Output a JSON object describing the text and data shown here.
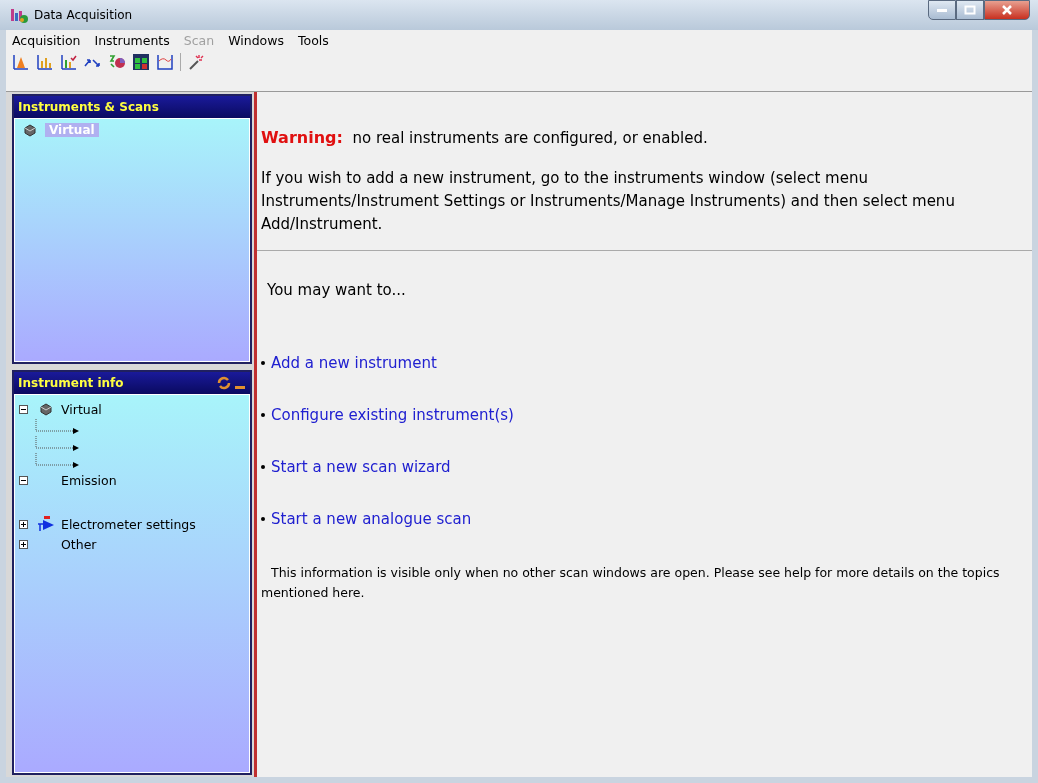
{
  "window": {
    "title": "Data Acquisition"
  },
  "menu": [
    {
      "label": "Acquisition",
      "disabled": false
    },
    {
      "label": "Instruments",
      "disabled": false
    },
    {
      "label": "Scan",
      "disabled": true
    },
    {
      "label": "Windows",
      "disabled": false
    },
    {
      "label": "Tools",
      "disabled": false
    }
  ],
  "instruments_panel": {
    "title": "Instruments & Scans",
    "items": [
      {
        "label": "Virtual",
        "selected": true
      }
    ]
  },
  "info_panel": {
    "title": "Instrument info",
    "tree": [
      {
        "label": "Virtual",
        "kind": "instrument",
        "expanded": true,
        "children": [
          {
            "kind": "pointer"
          },
          {
            "kind": "pointer"
          },
          {
            "kind": "pointer"
          }
        ]
      },
      {
        "label": "Emission",
        "kind": "plain",
        "expanded": true
      },
      {
        "label": "Electrometer settings",
        "kind": "electrometer",
        "expanded": false
      },
      {
        "label": "Other",
        "kind": "plain",
        "expanded": false
      }
    ]
  },
  "warning": {
    "title": "Warning:",
    "message": "no real instruments are configured, or enabled.",
    "help": "If you wish to add a new instrument, go to the instruments window (select menu Instruments/Instrument Settings or Instruments/Manage Instruments) and  then select menu Add/Instrument."
  },
  "suggestions": {
    "intro": "You may want to...",
    "links": [
      "Add a new instrument",
      "Configure existing instrument(s)",
      "Start a new scan wizard",
      "Start a new analogue scan"
    ],
    "note": "This information is visible only when no other scan windows are open. Please see help for more details on the topics mentioned here."
  }
}
